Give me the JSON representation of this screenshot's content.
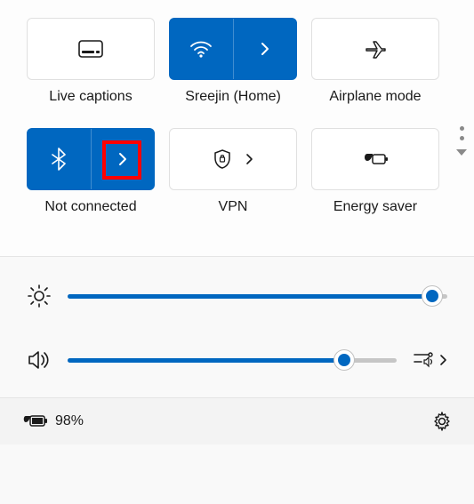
{
  "tiles": {
    "live_captions": {
      "label": "Live captions",
      "active": false
    },
    "wifi": {
      "label": "Sreejin (Home)",
      "active": true
    },
    "airplane": {
      "label": "Airplane mode",
      "active": false
    },
    "bluetooth": {
      "label": "Not connected",
      "active": true
    },
    "vpn": {
      "label": "VPN",
      "active": false
    },
    "energy": {
      "label": "Energy saver",
      "active": false
    }
  },
  "sliders": {
    "brightness": {
      "percent": 96
    },
    "volume": {
      "percent": 84
    }
  },
  "footer": {
    "battery_percent": "98%"
  },
  "colors": {
    "accent": "#0067c0"
  }
}
